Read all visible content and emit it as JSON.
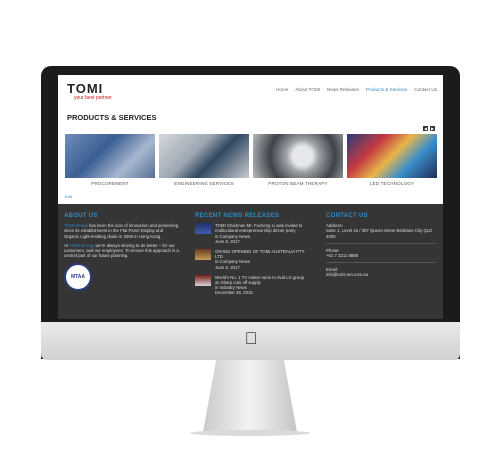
{
  "site": {
    "logo_text": "TOMI",
    "tagline": "your best partner"
  },
  "nav": [
    "Home",
    "About TOMI",
    "News Releases",
    "Products & Services",
    "Contact Us"
  ],
  "page_title": "PRODUCTS & SERVICES",
  "products": [
    "PROCUREMENT",
    "ENGINEERING SERVICES",
    "PROTON BEAM THERAPY",
    "LED TECHNOLOGY"
  ],
  "edit_link": "Edit",
  "about": {
    "heading": "ABOUT US",
    "link1": "TOMI Group",
    "text1": " has been the icon of innovation and pioneering since its establishment in the Flat Panel Display and Organic Light-emitting diode in 2006 in Hong Kong.",
    "text2a": "At ",
    "link2": "TOMI Group",
    "text2b": ", we're always striving to do better – for our customers, and our employees. To ensure this approach is a central part of our future planning.",
    "badge": "MTAA"
  },
  "news": {
    "heading": "RECENT NEWS RELEASES",
    "items": [
      {
        "title": "TOMI Chairman Mr. Fucheng Li was invited to multicultural entrepreneurship dinner party",
        "cat": "in Company News",
        "date": "June 8, 2017"
      },
      {
        "title": "GRAND OPENING OF TOMI AUSTRALIA PTY LTD",
        "cat": "in Company News",
        "date": "June 6, 2017"
      },
      {
        "title": "World's No. 1 TV maker turns to rival LG group as Sharp cuts off supply",
        "cat": "in Industry News",
        "date": "December 28, 2016"
      }
    ]
  },
  "contact": {
    "heading": "CONTACT US",
    "address_label": "Address:",
    "address": "Suite 1, Level 16 / 307 Queen Street Brisbane City QLD 4000",
    "phone_label": "Phone:",
    "phone": "+61 7 3211 8888",
    "email_label": "Email:",
    "email": "info@tomi-am.com.au"
  }
}
